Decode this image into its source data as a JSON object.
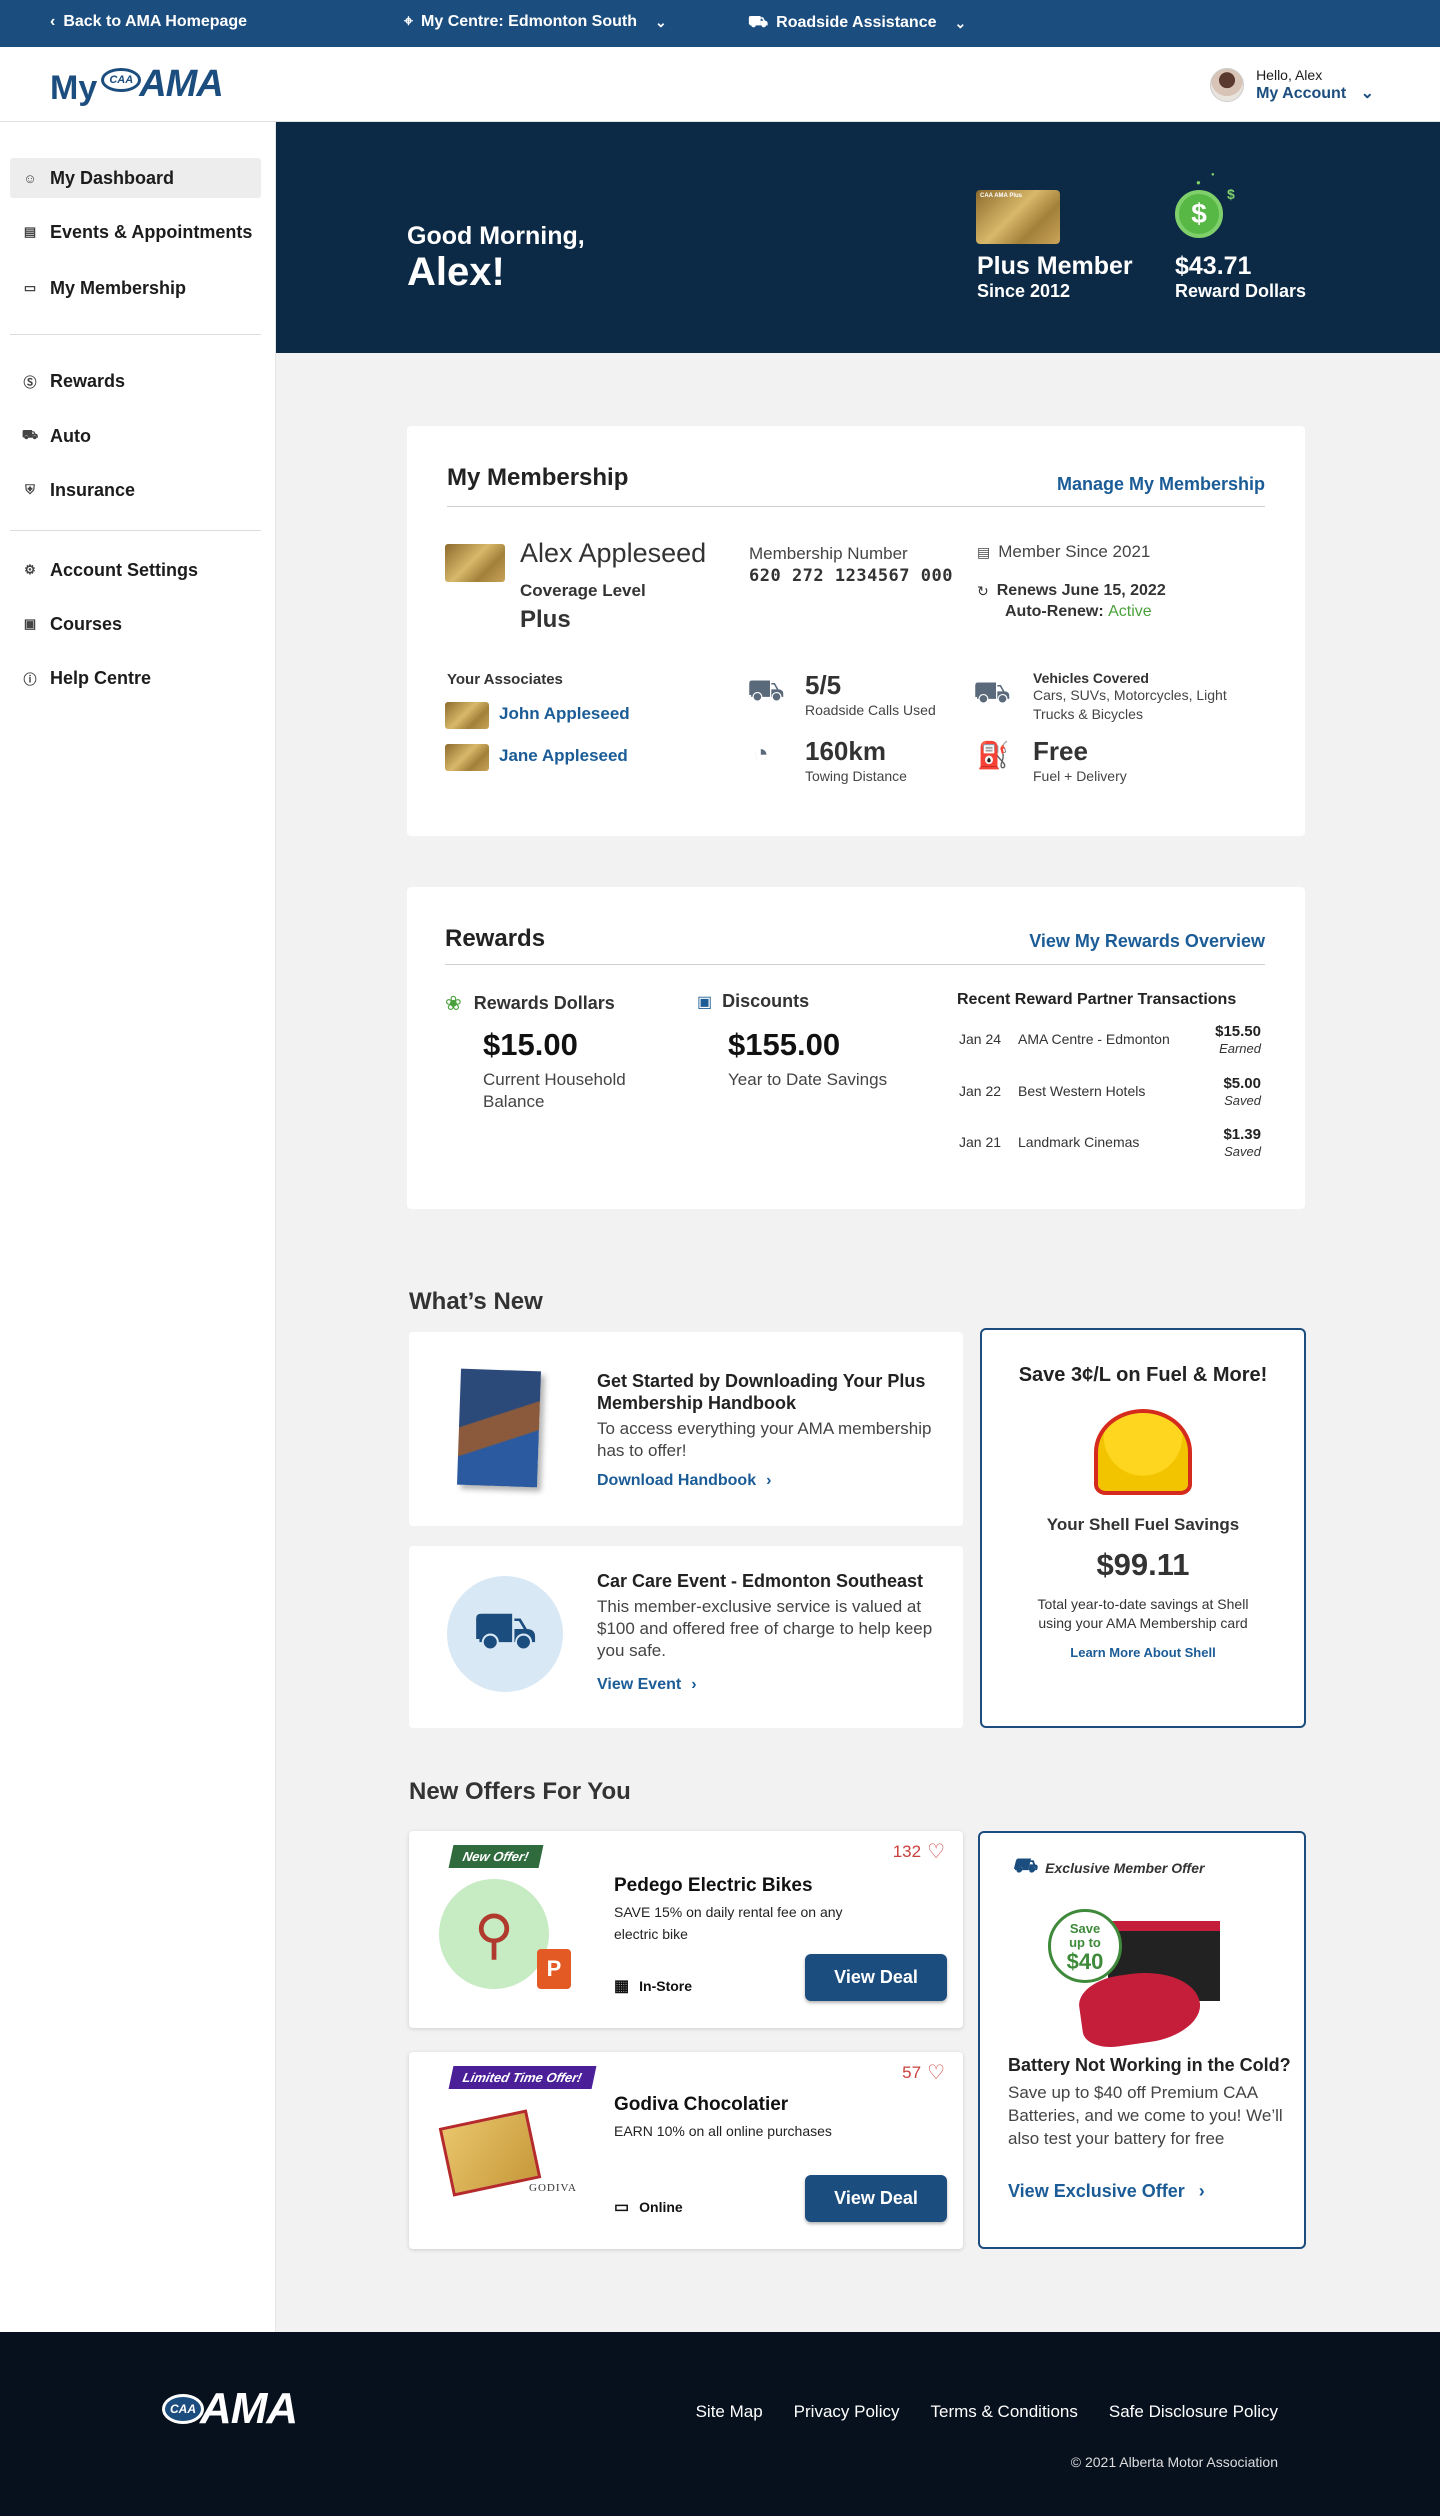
{
  "topbar": {
    "back": "Back to AMA Homepage",
    "centre": "My Centre: Edmonton South",
    "roadside": "Roadside Assistance"
  },
  "header": {
    "logo_my": "My",
    "logo_caa": "CAA",
    "logo_ama": "AMA",
    "hello": "Hello, Alex",
    "my_account": "My Account"
  },
  "sidebar": {
    "items": [
      {
        "label": "My Dashboard",
        "icon": "user-icon"
      },
      {
        "label": "Events & Appointments",
        "icon": "calendar-icon"
      },
      {
        "label": "My Membership",
        "icon": "card-icon"
      },
      {
        "label": "Rewards",
        "icon": "dollar-icon"
      },
      {
        "label": "Auto",
        "icon": "car-icon"
      },
      {
        "label": "Insurance",
        "icon": "shield-icon"
      },
      {
        "label": "Account Settings",
        "icon": "gear-icon"
      },
      {
        "label": "Courses",
        "icon": "id-card-icon"
      },
      {
        "label": "Help Centre",
        "icon": "info-icon"
      }
    ]
  },
  "hero": {
    "greeting": "Good Morning,",
    "name": "Alex!",
    "member_level": "Plus Member",
    "member_since": "Since 2012",
    "reward_amount": "$43.71",
    "reward_label": "Reward Dollars"
  },
  "membership": {
    "title": "My Membership",
    "manage": "Manage My Membership",
    "name": "Alex Appleseed",
    "coverage_label": "Coverage Level",
    "coverage": "Plus",
    "number_label": "Membership Number",
    "number": "620 272 1234567 000",
    "since": "Member Since 2021",
    "renews": "Renews June 15, 2022",
    "autorenew_label": "Auto-Renew:",
    "autorenew_value": "Active",
    "associates_label": "Your Associates",
    "associates": [
      "John Appleseed",
      "Jane Appleseed"
    ],
    "calls_value": "5/5",
    "calls_label": "Roadside Calls Used",
    "towing_value": "160km",
    "towing_label": "Towing Distance",
    "vehicles_title": "Vehicles Covered",
    "vehicles_desc": "Cars, SUVs, Motorcycles, Light Trucks & Bicycles",
    "fuel_value": "Free",
    "fuel_label": "Fuel + Delivery"
  },
  "rewards": {
    "title": "Rewards",
    "overview": "View My Rewards Overview",
    "dollars_label": "Rewards Dollars",
    "dollars_value": "$15.00",
    "dollars_sub": "Current Household Balance",
    "discounts_label": "Discounts",
    "discounts_value": "$155.00",
    "discounts_sub": "Year to Date Savings",
    "tx_title": "Recent Reward Partner Transactions",
    "transactions": [
      {
        "date": "Jan 24",
        "name": "AMA Centre - Edmonton",
        "amount": "$15.50",
        "kind": "Earned"
      },
      {
        "date": "Jan 22",
        "name": "Best Western Hotels",
        "amount": "$5.00",
        "kind": "Saved"
      },
      {
        "date": "Jan 21",
        "name": "Landmark Cinemas",
        "amount": "$1.39",
        "kind": "Saved"
      }
    ]
  },
  "whats_new": {
    "title": "What’s New",
    "items": [
      {
        "title": "Get Started by Downloading Your Plus Membership Handbook",
        "body": "To access everything your AMA membership has to offer!",
        "link": "Download Handbook"
      },
      {
        "title": "Car Care Event - Edmonton Southeast",
        "body": "This member-exclusive service is valued at $100 and offered free of charge to help keep you safe.",
        "link": "View Event"
      }
    ],
    "shell": {
      "title": "Save 3¢/L on Fuel & More!",
      "savings_label": "Your Shell Fuel Savings",
      "savings_value": "$99.11",
      "desc": "Total year-to-date savings at Shell using your AMA Membership card",
      "link": "Learn More About Shell"
    }
  },
  "offers": {
    "title": "New Offers For You",
    "items": [
      {
        "ribbon": "New Offer!",
        "likes": "132",
        "title": "Pedego Electric Bikes",
        "desc": "SAVE 15% on daily rental fee on any electric bike",
        "where": "In-Store",
        "button": "View Deal"
      },
      {
        "ribbon": "Limited Time Offer!",
        "likes": "57",
        "title": "Godiva Chocolatier",
        "desc": "EARN 10% on all online purchases",
        "where": "Online",
        "button": "View Deal",
        "brand": "GODIVA"
      }
    ],
    "exclusive": {
      "tag": "Exclusive Member Offer",
      "badge_top": "Save",
      "badge_mid": "up to",
      "badge_amount": "$40",
      "title": "Battery Not Working in the Cold?",
      "desc": "Save up to $40 off Premium CAA Batteries, and we come to you! We’ll also test your battery for free",
      "link": "View Exclusive Offer"
    }
  },
  "footer": {
    "logo_caa": "CAA",
    "logo_ama": "AMA",
    "links": [
      "Site Map",
      "Privacy Policy",
      "Terms & Conditions",
      "Safe Disclosure Policy"
    ],
    "copyright": "© 2021 Alberta Motor Association"
  },
  "colors": {
    "brand_blue": "#1b4d7e",
    "hero_navy": "#0c2a46",
    "link_blue": "#1b5c97",
    "reward_green": "#58b846",
    "footer_bg": "#07111d"
  }
}
